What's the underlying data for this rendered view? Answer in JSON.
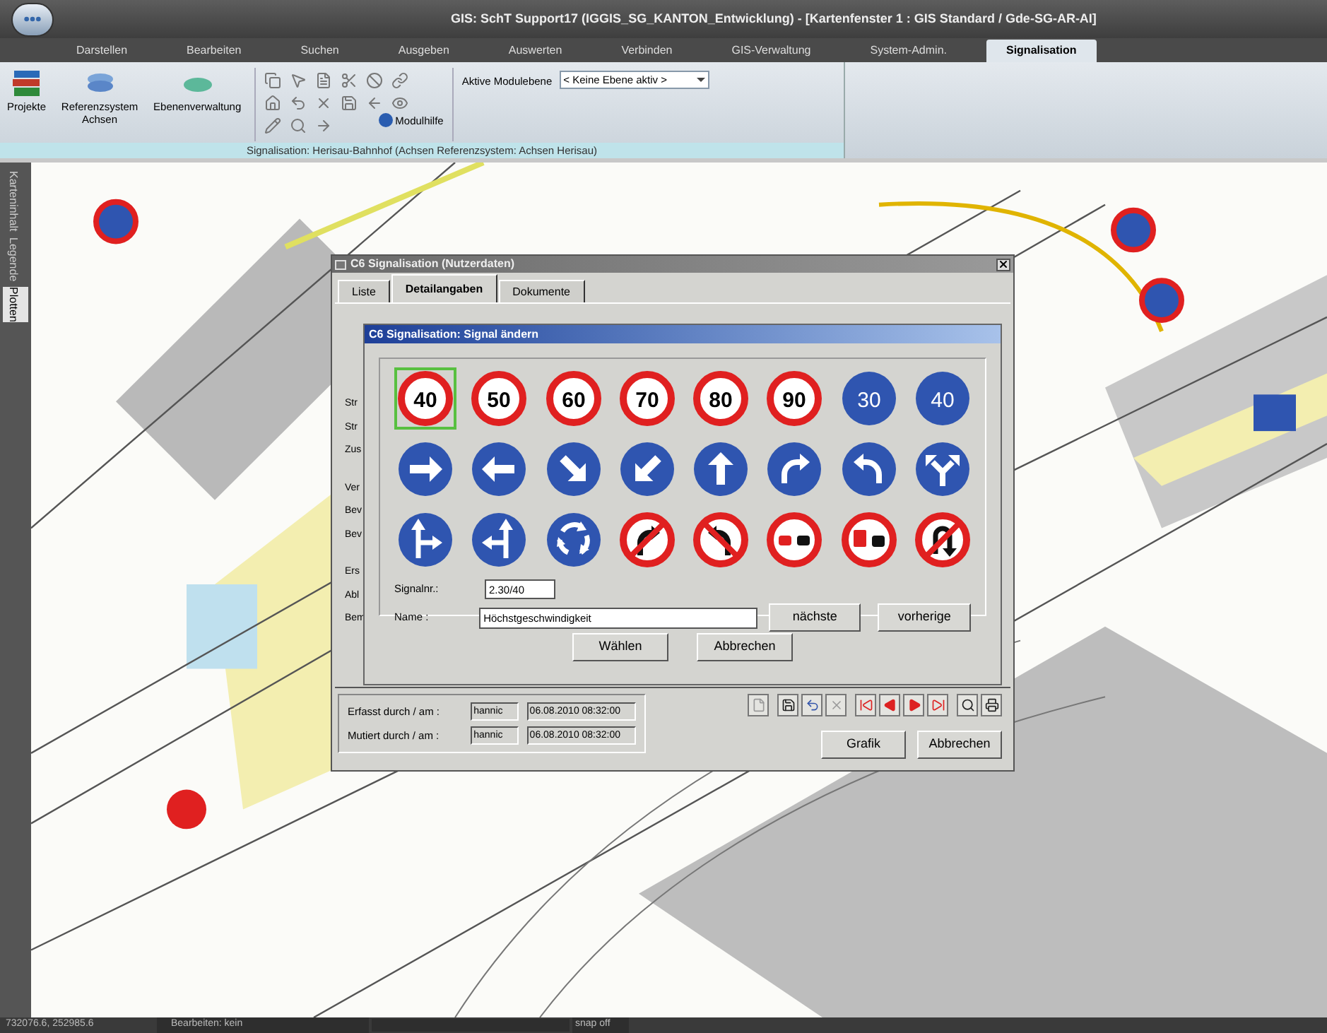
{
  "window": {
    "title": "GIS: SchT Support17 (IGGIS_SG_KANTON_Entwicklung) - [Kartenfenster 1 : GIS Standard / Gde-SG-AR-AI]"
  },
  "menu_tabs": [
    {
      "label": "Darstellen",
      "selected": false
    },
    {
      "label": "Bearbeiten",
      "selected": false
    },
    {
      "label": "Suchen",
      "selected": false
    },
    {
      "label": "Ausgeben",
      "selected": false
    },
    {
      "label": "Auswerten",
      "selected": false
    },
    {
      "label": "Verbinden",
      "selected": false
    },
    {
      "label": "GIS-Verwaltung",
      "selected": false
    },
    {
      "label": "System-Admin.",
      "selected": false
    },
    {
      "label": "Signalisation",
      "selected": true
    }
  ],
  "ribbon": {
    "large_buttons": [
      {
        "kind": "books",
        "label": "Projekte"
      },
      {
        "kind": "layers",
        "label": "Referenzsystem Achsen"
      },
      {
        "kind": "disc",
        "label": "Ebenenverwaltung"
      }
    ],
    "help_button": {
      "label": "Modulhilfe"
    },
    "module_level": {
      "label": "Aktive Modulebene",
      "value": "< Keine Ebene aktiv >"
    },
    "group_label": "Signalisation:  Herisau-Bahnhof (Achsen Referenzsystem: Achsen Herisau)"
  },
  "side_tabs": [
    {
      "label": "Karteninhalt",
      "selected": false
    },
    {
      "label": "Legende",
      "selected": false
    },
    {
      "label": "Plotten",
      "selected": true
    }
  ],
  "dialog": {
    "title": "C6 Signalisation (Nutzerdaten)",
    "tabs": [
      {
        "label": "Liste",
        "selected": false
      },
      {
        "label": "Detailangaben",
        "selected": true
      },
      {
        "label": "Dokumente",
        "selected": false
      }
    ],
    "background_labels": [
      "Str",
      "Str",
      "Zus",
      "Ver",
      "Bev",
      "Bev",
      "Ers",
      "Abl",
      "Bem"
    ],
    "signal_dialog": {
      "title": "C6 Signalisation: Signal ändern",
      "signs": [
        {
          "kind": "limit",
          "label": "40",
          "selected": true
        },
        {
          "kind": "limit",
          "label": "50",
          "selected": false
        },
        {
          "kind": "limit",
          "label": "60",
          "selected": false
        },
        {
          "kind": "limit",
          "label": "70",
          "selected": false
        },
        {
          "kind": "limit",
          "label": "80",
          "selected": false
        },
        {
          "kind": "limit",
          "label": "90",
          "selected": false
        },
        {
          "kind": "minimum",
          "label": "30",
          "selected": false
        },
        {
          "kind": "minimum",
          "label": "40",
          "selected": false
        },
        {
          "kind": "right",
          "selected": false
        },
        {
          "kind": "left",
          "selected": false
        },
        {
          "kind": "downright",
          "selected": false
        },
        {
          "kind": "downleft",
          "selected": false
        },
        {
          "kind": "up",
          "selected": false
        },
        {
          "kind": "turnright",
          "selected": false
        },
        {
          "kind": "turnleft",
          "selected": false
        },
        {
          "kind": "fork",
          "selected": false
        },
        {
          "kind": "upright",
          "selected": false
        },
        {
          "kind": "upleft",
          "selected": false
        },
        {
          "kind": "roundabout",
          "selected": false
        },
        {
          "kind": "norightturn",
          "selected": false
        },
        {
          "kind": "noleftturn",
          "selected": false
        },
        {
          "kind": "noovertaking",
          "selected": false
        },
        {
          "kind": "notrucksovertaking",
          "selected": false
        },
        {
          "kind": "nouturn",
          "selected": false
        }
      ],
      "number_label": "Signalnr.:",
      "number": "2.30/40",
      "name_label": "Name :",
      "name": "Höchstgeschwindigkeit",
      "next_button": "nächste",
      "prev_button": "vorherige",
      "buttons": [
        "Wählen",
        "Abbrechen"
      ]
    },
    "audit": [
      {
        "label": "Erfasst durch / am :",
        "user": "hannic",
        "date": "06.08.2010 08:32:00"
      },
      {
        "label": "Mutiert durch / am :",
        "user": "hannic",
        "date": "06.08.2010 08:32:00"
      }
    ],
    "buttons": [
      "Grafik",
      "Abbrechen"
    ]
  },
  "status_bar": {
    "coordinates": "732076.6, 252985.6",
    "mode": "Bearbeiten: kein",
    "snap": "snap off"
  }
}
